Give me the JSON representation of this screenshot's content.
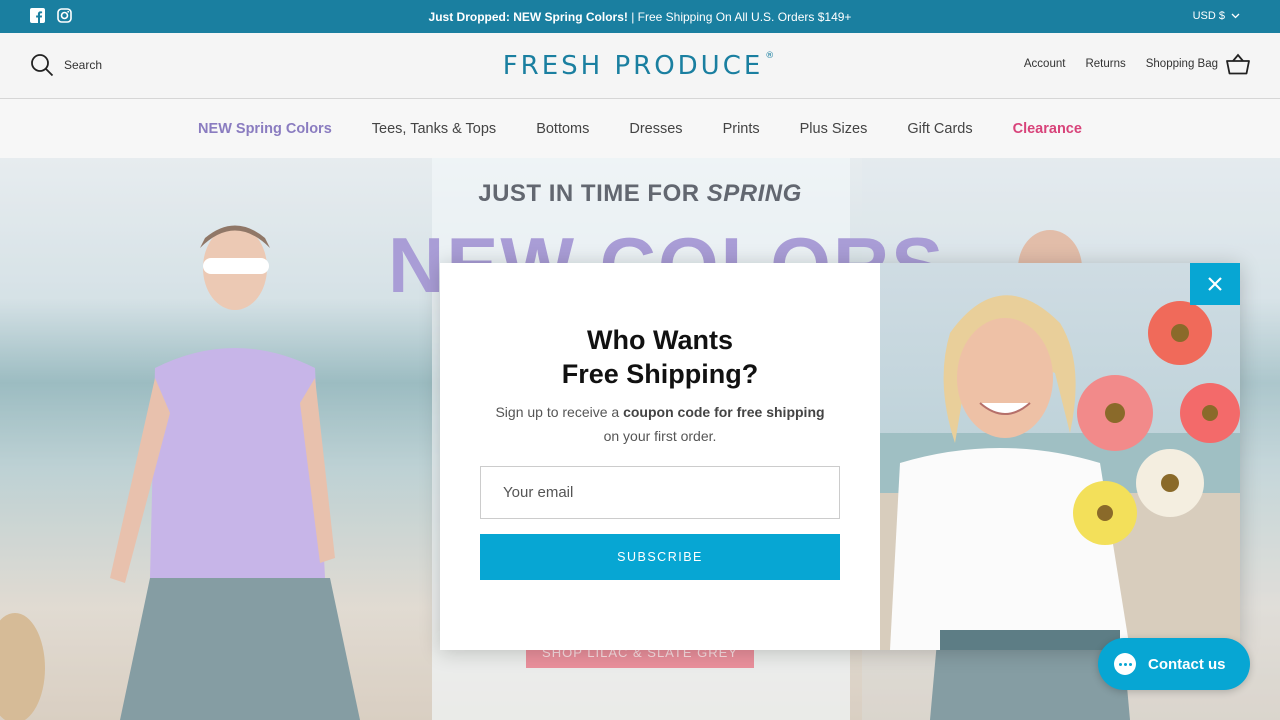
{
  "announcement": {
    "bold_text": "Just Dropped: NEW Spring Colors!",
    "text": " | Free Shipping On All U.S. Orders $149+",
    "currency": "USD $",
    "social_icons": [
      "facebook-icon",
      "instagram-icon"
    ]
  },
  "header": {
    "search_label": "Search",
    "logo_text": "FRESH PRODUCE",
    "logo_mark": "®",
    "account_label": "Account",
    "returns_label": "Returns",
    "bag_label": "Shopping Bag"
  },
  "nav": {
    "items": [
      {
        "label": "NEW Spring Colors",
        "style": "highlight-purple"
      },
      {
        "label": "Tees, Tanks & Tops",
        "style": "normal"
      },
      {
        "label": "Bottoms",
        "style": "normal"
      },
      {
        "label": "Dresses",
        "style": "normal"
      },
      {
        "label": "Prints",
        "style": "normal"
      },
      {
        "label": "Plus Sizes",
        "style": "normal"
      },
      {
        "label": "Gift Cards",
        "style": "normal"
      },
      {
        "label": "Clearance",
        "style": "highlight-pink"
      }
    ]
  },
  "hero": {
    "tagline_prefix": "JUST IN TIME FOR ",
    "tagline_italic": "SPRING",
    "headline": "NEW COLORS",
    "shop_button": "SHOP LILAC & SLATE GREY"
  },
  "popup": {
    "title_line1": "Who Wants",
    "title_line2": "Free Shipping?",
    "sub_prefix": "Sign up to receive a ",
    "sub_bold": "coupon code for free shipping",
    "sub_suffix": "on your first order.",
    "email_placeholder": "Your email",
    "subscribe_label": "SUBSCRIBE"
  },
  "contact": {
    "label": "Contact us"
  },
  "colors": {
    "brand_teal": "#1a7fa0",
    "subscribe_blue": "#07a6d3",
    "spring_purple": "#8a7cc0",
    "clearance_pink": "#d8437a"
  }
}
